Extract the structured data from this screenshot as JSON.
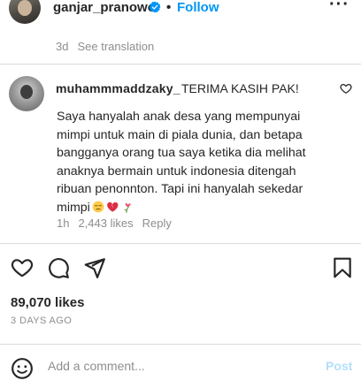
{
  "post_header": {
    "username": "ganjar_pranowo",
    "separator": "•",
    "follow_label": "Follow",
    "more_icon": "more-horizontal-icon"
  },
  "caption_meta": {
    "age": "3d",
    "see_translation": "See translation"
  },
  "comment": {
    "username": "muhammmaddzaky_",
    "headline": "TERIMA KASIH PAK!",
    "lines": [
      "Saya hanyalah anak desa yang mempunyai",
      "mimpi untuk main di piala dunia, dan betapa",
      "bangganya orang tua saya ketika dia melihat",
      "anaknya bermain untuk indonesia ditengah",
      "ribuan penonnton. Tapi ini hanyalah sekedar",
      "mimpi"
    ],
    "emojis": [
      "pensive-face",
      "broken-heart",
      "wilted-flower"
    ],
    "age": "1h",
    "likes": "2,443 likes",
    "reply_label": "Reply"
  },
  "actions": {
    "likes": "89,070 likes",
    "posted_ago": "3 DAYS AGO"
  },
  "add_comment": {
    "placeholder": "Add a comment...",
    "post_label": "Post"
  },
  "colors": {
    "text": "#262626",
    "muted": "#8e8e8e",
    "link_blue": "#0095f6",
    "post_disabled": "#b2dffc",
    "verified_blue": "#0095f6",
    "divider": "#dbdbdb"
  }
}
